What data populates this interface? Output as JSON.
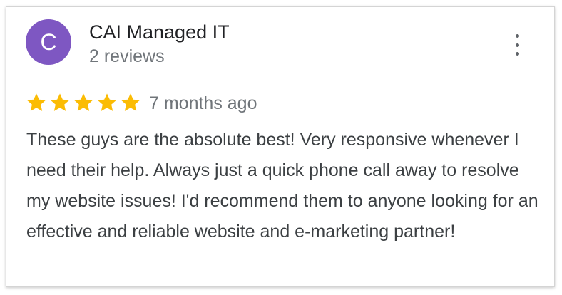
{
  "review": {
    "avatar_letter": "C",
    "avatar_color": "#7e57c2",
    "reviewer_name": "CAI Managed IT",
    "review_count": "2 reviews",
    "menu_icon": "more-vertical-icon",
    "rating": 5,
    "rating_max": 5,
    "star_color": "#fbbc04",
    "time_ago": "7 months ago",
    "text": "These guys are the absolute best!  Very responsive whenever I need their help. Always just a quick phone call away to resolve my website issues! I'd recommend them to anyone looking for an effective and reliable website and e-marketing partner!"
  }
}
